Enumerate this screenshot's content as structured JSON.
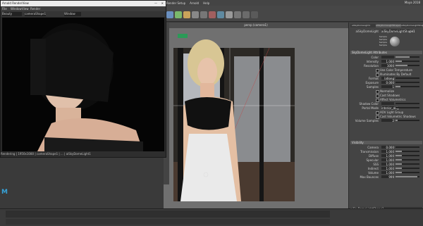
{
  "render_view": {
    "title": "Arnold RenderView",
    "menu": [
      "File",
      "Window",
      "View",
      "Render"
    ],
    "toolbar": {
      "camera": "Beauty",
      "display": "cameraShape1",
      "zoom": "Window"
    },
    "status": "Rendering | 1950x1080 | cameraShape1 | ... | aiSkyDomeLight1"
  },
  "viewport": {
    "panel_label": "persp (camera1)"
  },
  "maya": {
    "title_right": "Maya 2018",
    "menus": [
      "Render Setup",
      "Arnold",
      "Help",
      "Lighting/Shading",
      "Texturing",
      "Render"
    ]
  },
  "attribute_editor": {
    "tabs": [
      "aiSkyDomeLight1",
      "aiSkyDomeLightShape1",
      "aiSkyDomeLightShape2"
    ],
    "node_label": "aiSkyDomeLight",
    "node_value": "aiSkyDomeLightShape1",
    "sample_labels": [
      "Sample",
      "Sample",
      "Sample",
      "Sample"
    ],
    "section_attrs": "SkyDomeLight Attributes",
    "attrs": [
      {
        "label": "Color",
        "value": "",
        "fill": 0.6
      },
      {
        "label": "Intensity",
        "value": "1.000",
        "fill": 0.25
      },
      {
        "label": "Resolution",
        "value": "1000",
        "fill": 0.5
      }
    ],
    "checks": [
      "Use Color Temperature",
      "Illuminates By Default"
    ],
    "attrs2": [
      {
        "label": "Format",
        "value": "latlong",
        "fill": 0.0
      },
      {
        "label": "Exposure",
        "value": "0.000",
        "fill": 0.0
      },
      {
        "label": "Samples",
        "value": "1",
        "fill": 0.2
      }
    ],
    "checks2": [
      "Normalize",
      "Cast Shadows",
      "Affect Volumetrics"
    ],
    "attrs3": [
      {
        "label": "Shadow Color",
        "value": "",
        "fill": 0.0
      },
      {
        "label": "Portal Mode",
        "value": "interior_only",
        "fill": 0.0
      }
    ],
    "checks3": [
      "AOV Light Group",
      "Cast Volumetric Shadows"
    ],
    "volume_samples": {
      "label": "Volume Samples",
      "value": "2",
      "fill": 0.1
    },
    "section_vis": "Visibility",
    "visibility": [
      {
        "label": "Camera",
        "value": "0.000",
        "fill": 0.0
      },
      {
        "label": "Transmission",
        "value": "1.000",
        "fill": 0.25
      },
      {
        "label": "Diffuse",
        "value": "1.000",
        "fill": 0.25
      },
      {
        "label": "Specular",
        "value": "1.000",
        "fill": 0.25
      },
      {
        "label": "SSS",
        "value": "1.000",
        "fill": 0.25
      },
      {
        "label": "Indirect",
        "value": "1.000",
        "fill": 0.25
      },
      {
        "label": "Volume",
        "value": "1.000",
        "fill": 0.25
      },
      {
        "label": "Max Bounces",
        "value": "999",
        "fill": 0.9
      }
    ],
    "footer_node": "aiSkyDomeLightShape1"
  },
  "colors": {
    "accent": "#36a3d9",
    "panel": "#444444"
  }
}
